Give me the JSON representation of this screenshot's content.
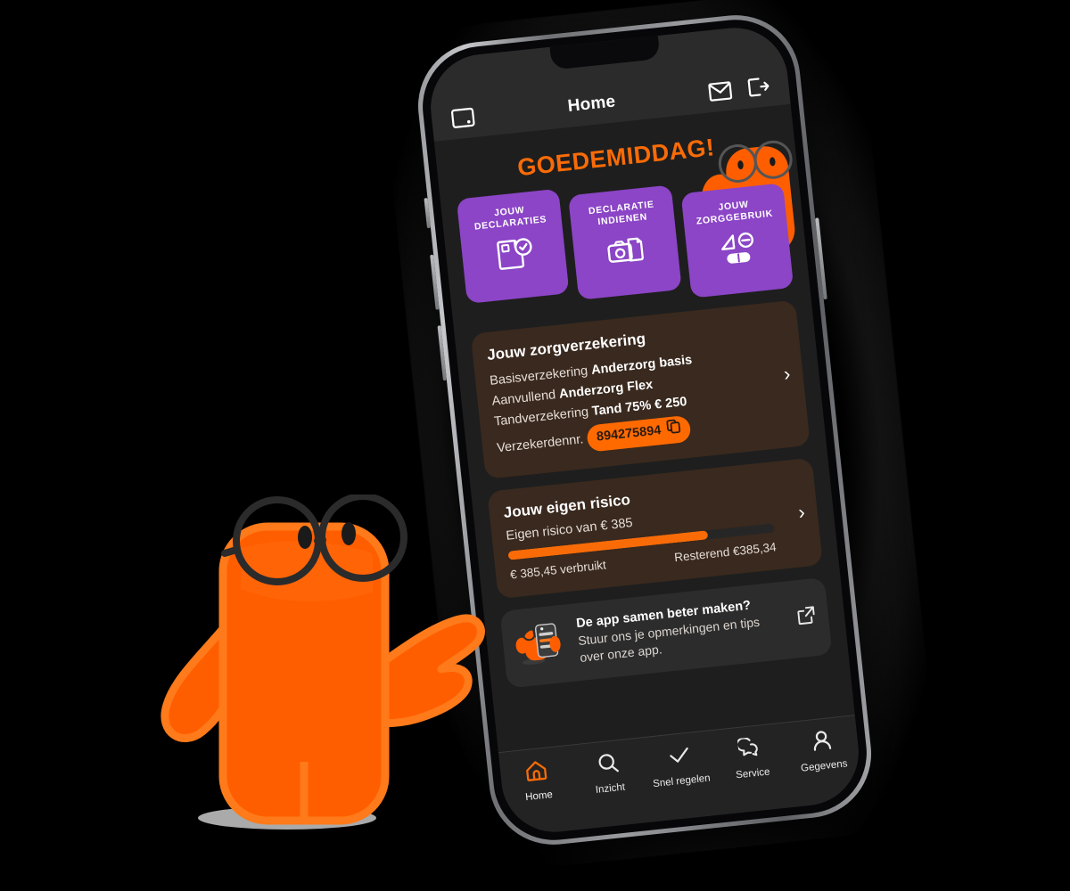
{
  "app": {
    "header": {
      "title": "Home",
      "left_icon": "insurance-card-icon",
      "icons": [
        "mail-icon",
        "logout-icon"
      ]
    },
    "greeting": "GOEDEMIDDAG!",
    "quick_actions": [
      {
        "label": "JOUW DECLARATIES",
        "icon": "document-check-icon"
      },
      {
        "label": "DECLARATIE INDIENEN",
        "icon": "camera-receipt-icon"
      },
      {
        "label": "JOUW ZORGGEBRUIK",
        "icon": "pill-icon"
      }
    ],
    "insurance_card": {
      "title": "Jouw zorgverzekering",
      "rows": [
        {
          "label": "Basisverzekering",
          "value": "Anderzorg basis"
        },
        {
          "label": "Aanvullend",
          "value": "Anderzorg Flex"
        },
        {
          "label": "Tandverzekering",
          "value": "Tand 75% € 250"
        }
      ],
      "policy_label": "Verzekerdennr.",
      "policy_number": "894275894",
      "copy_icon": "copy-icon",
      "chevron": "›"
    },
    "deductible_card": {
      "title": "Jouw eigen risico",
      "subtitle": "Eigen risico van € 385",
      "progress_percent": 75,
      "used_label": "€ 385,45 verbruikt",
      "remaining_label": "Resterend €385,34",
      "chevron": "›"
    },
    "feedback_banner": {
      "title": "De app samen beter maken?",
      "body": "Stuur ons je opmerkingen en tips over onze app.",
      "icon": "mascot-phone-icon",
      "action_icon": "external-link-icon"
    },
    "tabs": [
      {
        "label": "Home",
        "icon": "home-icon",
        "active": true
      },
      {
        "label": "Inzicht",
        "icon": "search-icon",
        "active": false
      },
      {
        "label": "Snel regelen",
        "icon": "check-icon",
        "active": false
      },
      {
        "label": "Service",
        "icon": "chat-icon",
        "active": false
      },
      {
        "label": "Gegevens",
        "icon": "person-icon",
        "active": false
      }
    ]
  },
  "scene": {
    "mascot": "orange-mascot-with-glasses",
    "peeking_mascot": "orange-mascot-peeking",
    "device": "smartphone-mockup"
  },
  "colors": {
    "background": "#000000",
    "accent_orange": "#F96B07",
    "badge_orange": "#FF6A00",
    "purple": "#8B45C6",
    "card_brown": "#39291E",
    "screen_dark": "#1E1E1E",
    "appbar": "#2B2B2B",
    "tabbar": "#232323"
  }
}
